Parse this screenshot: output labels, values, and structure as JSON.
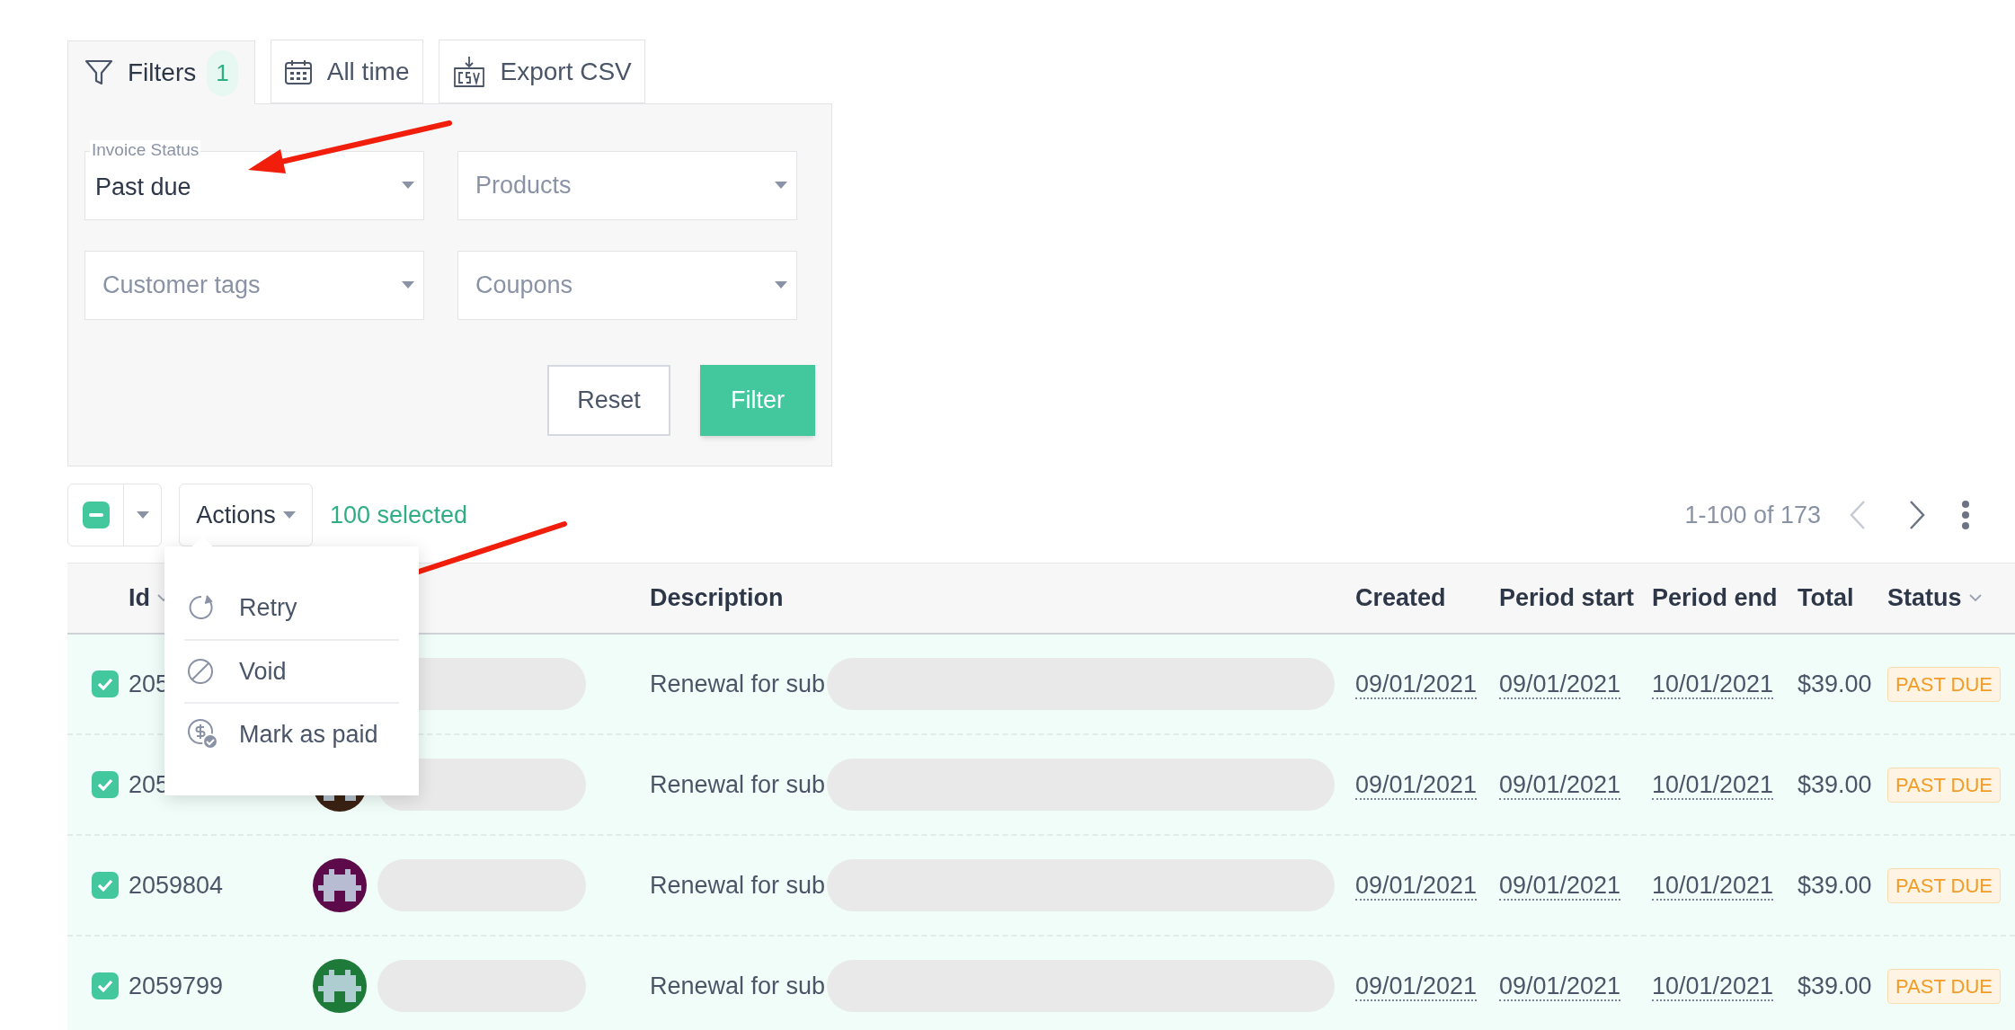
{
  "filter_tabs": [
    {
      "kind": "filters",
      "label": "Filters",
      "count": "1",
      "selected": true
    },
    {
      "kind": "date",
      "label": "All time",
      "selected": false
    },
    {
      "kind": "export",
      "label": "Export CSV",
      "selected": false
    }
  ],
  "filters": {
    "fields": [
      {
        "label": "Invoice Status",
        "value": "Past due"
      },
      {
        "placeholder": "Products"
      },
      {
        "placeholder": "Customer tags"
      },
      {
        "placeholder": "Coupons"
      }
    ],
    "buttons": [
      {
        "kind": "secondary",
        "label": "Reset"
      },
      {
        "kind": "primary",
        "label": "Filter"
      }
    ]
  },
  "toolbar": {
    "select_all_indeterminate": true,
    "actions_label": "Actions",
    "selected_count": "100 selected",
    "pagination": "1-100 of 173"
  },
  "actions_menu": {
    "expanded": true,
    "items": [
      {
        "kind": "retry",
        "label": "Retry"
      },
      {
        "kind": "void",
        "label": "Void"
      },
      {
        "kind": "paid",
        "label": "Mark as paid"
      }
    ]
  },
  "table": {
    "columns": [
      {
        "label": "Id",
        "sortable": true
      },
      {
        "label": "Description",
        "sortable": false
      },
      {
        "label": "Created",
        "sortable": false
      },
      {
        "label": "Period start",
        "sortable": false
      },
      {
        "label": "Period end",
        "sortable": false
      },
      {
        "label": "Total",
        "sortable": false
      },
      {
        "label": "Status",
        "sortable": true
      }
    ],
    "rows": [
      {
        "checked": true,
        "id": "205",
        "description": "Renewal for sub",
        "created": "09/01/2021",
        "period_start": "09/01/2021",
        "period_end": "10/01/2021",
        "total": "$39.00",
        "status": "PAST DUE"
      },
      {
        "checked": true,
        "id": "205",
        "avatar": {
          "color": "#3a2212"
        },
        "description": "Renewal for sub",
        "created": "09/01/2021",
        "period_start": "09/01/2021",
        "period_end": "10/01/2021",
        "total": "$39.00",
        "status": "PAST DUE"
      },
      {
        "checked": true,
        "id": "2059804",
        "avatar": {
          "color": "#5c0a4a"
        },
        "description": "Renewal for sub",
        "created": "09/01/2021",
        "period_start": "09/01/2021",
        "period_end": "10/01/2021",
        "total": "$39.00",
        "status": "PAST DUE"
      },
      {
        "checked": true,
        "id": "2059799",
        "avatar": {
          "color": "#1e7a38"
        },
        "description": "Renewal for sub",
        "created": "09/01/2021",
        "period_start": "09/01/2021",
        "period_end": "10/01/2021",
        "total": "$39.00",
        "status": "PAST DUE"
      }
    ]
  }
}
